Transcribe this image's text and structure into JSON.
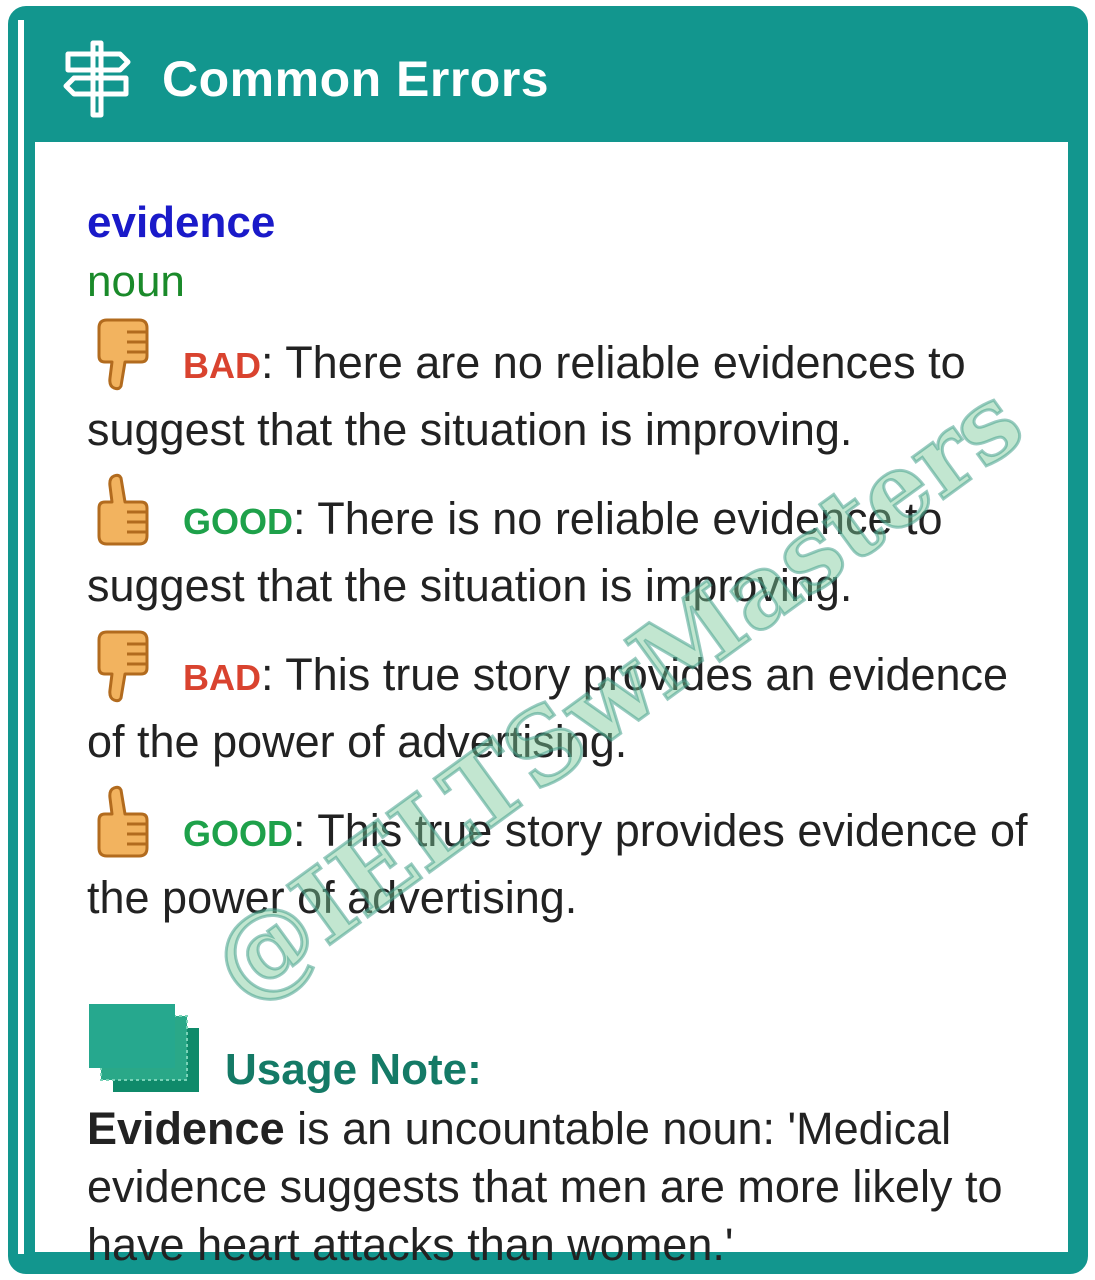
{
  "header": {
    "title": "Common Errors",
    "icon": "signpost-icon"
  },
  "entry": {
    "word": "evidence",
    "part_of_speech": "noun"
  },
  "examples": [
    {
      "tag": "BAD",
      "text": ": There are no reliable evidences to suggest that the situation is improving."
    },
    {
      "tag": "GOOD",
      "text": ": There is no reliable evidence to suggest that the situation is improving."
    },
    {
      "tag": "BAD",
      "text": ": This true story provides an evidence of the power of advertising."
    },
    {
      "tag": "GOOD",
      "text": ": This true story provides evidence of the power of advertising."
    }
  ],
  "usage_note": {
    "title": "Usage Note:",
    "bold_word": "Evidence",
    "text": " is an uncountable noun: 'Medical evidence suggests that men are more likely to have heart attacks than women.'"
  },
  "watermark": "@IELTSwMasters",
  "colors": {
    "frame": "#12968e",
    "word": "#1a1ac9",
    "pos": "#1a8a2a",
    "bad": "#d9432f",
    "good": "#1ea14a",
    "note_title": "#147a66"
  }
}
